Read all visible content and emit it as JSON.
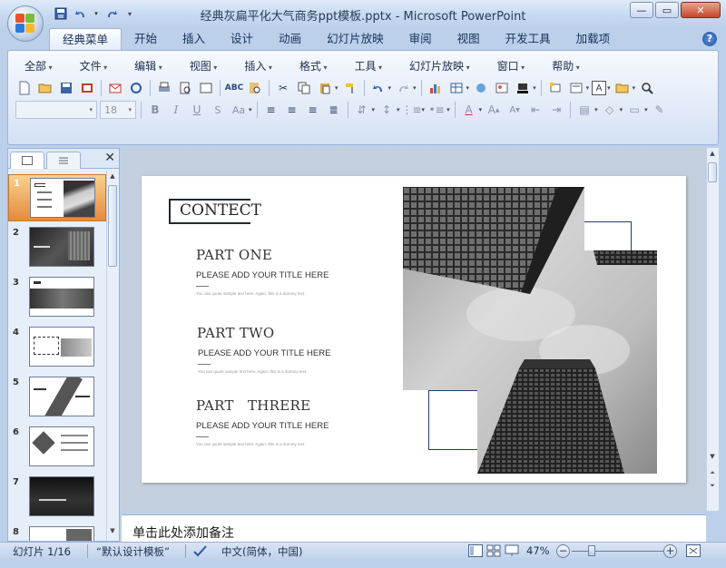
{
  "window": {
    "title": "经典灰扁平化大气商务ppt模板.pptx - Microsoft PowerPoint"
  },
  "ribbon_tabs": [
    "经典菜单",
    "开始",
    "插入",
    "设计",
    "动画",
    "幻灯片放映",
    "审阅",
    "视图",
    "开发工具",
    "加载项"
  ],
  "active_tab": "经典菜单",
  "menu": [
    "全部",
    "文件",
    "编辑",
    "视图",
    "插入",
    "格式",
    "工具",
    "幻灯片放映",
    "窗口",
    "帮助"
  ],
  "toolbar": {
    "font_size": "18"
  },
  "slide_panel": {
    "thumbnails": [
      {
        "num": "1",
        "selected": true
      },
      {
        "num": "2"
      },
      {
        "num": "3"
      },
      {
        "num": "4"
      },
      {
        "num": "5"
      },
      {
        "num": "6"
      },
      {
        "num": "7"
      },
      {
        "num": "8"
      }
    ]
  },
  "slide": {
    "heading": "CONTECT",
    "parts": [
      {
        "title": "PART ONE",
        "subtitle": "PLEASE ADD YOUR TITLE HERE",
        "desc": "You can quote sample text here. Again, this is a dummy text."
      },
      {
        "title": "PART TWO",
        "subtitle": "PLEASE ADD YOUR TITLE HERE",
        "desc": "You can quote sample text here. Again, this is a dummy text."
      },
      {
        "title": "PART   THRERE",
        "subtitle": "PLEASE ADD YOUR TITLE HERE",
        "desc": "You can quote sample text here. Again, this is a dummy text."
      }
    ]
  },
  "notes": {
    "placeholder": "单击此处添加备注"
  },
  "status": {
    "slide_info": "幻灯片 1/16",
    "template": "“默认设计模板”",
    "language": "中文(简体，中国)",
    "zoom": "47%",
    "zoom_out": "−",
    "zoom_in": "+"
  },
  "icons": {
    "office_button": "office-logo-icon",
    "save": "save-icon",
    "undo": "undo-icon",
    "redo": "redo-icon",
    "help": "help-icon"
  },
  "colors": {
    "accent_selected_thumb": "#e58a3d",
    "slide_frame_line": "#1e3e66"
  }
}
